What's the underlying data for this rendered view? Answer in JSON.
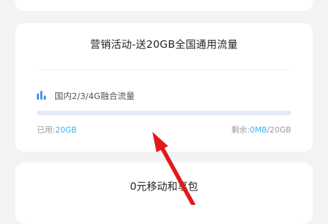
{
  "card": {
    "title": "营销活动-送20GB全国通用流量",
    "traffic": {
      "label": "国内2/3/4G融合流量",
      "used_label": "已用:",
      "used_value": "20GB",
      "remaining_label": "剩余:",
      "remaining_value": "0MB",
      "total": "/20GB",
      "remaining_fraction": 0
    }
  },
  "next_card": {
    "title": "0元移动和享包"
  },
  "icons": {
    "traffic": "bar-chart-icon"
  },
  "colors": {
    "accent": "#2db7f5",
    "progress_track": "#e4e9f7",
    "icon_blue": "#3d8ff0",
    "annotation_arrow": "#e01a1a"
  }
}
